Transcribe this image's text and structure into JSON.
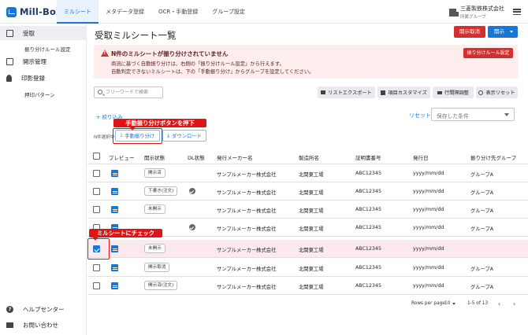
{
  "app": {
    "logo_text": "Mill-Box"
  },
  "nav": {
    "tabs": [
      {
        "label": "ミルシート",
        "active": true
      },
      {
        "label": "メタデータ登録",
        "active": false
      },
      {
        "label": "OCR・手動登録",
        "active": false
      },
      {
        "label": "グループ設定",
        "active": false
      }
    ]
  },
  "company": {
    "name": "三菱製鉄株式会社",
    "group": "所属グループ"
  },
  "sidebar": {
    "items": [
      {
        "label": "受取",
        "icon": "inbox-icon",
        "active": true
      },
      {
        "label": "振り分けルール設定",
        "sub": true
      },
      {
        "label": "開示管理",
        "icon": "share-icon"
      },
      {
        "label": "印影登録",
        "icon": "stamp-icon"
      },
      {
        "label": "押印パターン",
        "sub": true
      }
    ],
    "footer": [
      {
        "label": "ヘルプセンター",
        "icon": "help-icon"
      },
      {
        "label": "お問い合わせ",
        "icon": "mail-icon"
      }
    ]
  },
  "page": {
    "title": "受取ミルシート一覧",
    "cancel_button": "開示取消",
    "open_button": "開示"
  },
  "alert": {
    "title": "N件のミルシートが振り分けされていません",
    "line1": "商流に基づく自動振り分けは、右側の「振り分けルール設定」から行えます。",
    "line2": "自動判定できないミルシートは、下の「手動振り分け」からグループを設定してください。",
    "button": "振り分けルール設定"
  },
  "toolbar": {
    "search_placeholder": "フリーワードで検索",
    "buttons": [
      {
        "label": "リストエクスポート",
        "icon": "download-icon"
      },
      {
        "label": "項目カスタマイズ",
        "icon": "grid-icon"
      },
      {
        "label": "行間隔調整",
        "icon": "density-icon"
      },
      {
        "label": "表示リセット",
        "icon": "refresh-icon"
      }
    ]
  },
  "filters": {
    "add_filter": "+ 絞り込み",
    "reset": "リセット",
    "saved_placeholder": "保存した条件"
  },
  "selection": {
    "count_text": "N件選択中",
    "manual_assign": "手動振り分け",
    "download": "ダウンロード"
  },
  "callouts": {
    "manual_assign": "手動振り分けボタンを押下",
    "check_mill": "ミルシートにチェック"
  },
  "table": {
    "headers": [
      "プレビュー",
      "開示状態",
      "DL状態",
      "発行メーカー名",
      "製造所名",
      "証明書番号",
      "発行日",
      "振り分け先グループ"
    ],
    "rows": [
      {
        "checked": false,
        "status": "開示済",
        "dl": false,
        "maker": "サンプルメーカー株式会社",
        "plant": "北関東工場",
        "cert": "ABC12345",
        "date": "yyyy/mm/dd",
        "group": "グループA"
      },
      {
        "checked": false,
        "status": "下書き(注文)",
        "dl": true,
        "maker": "サンプルメーカー株式会社",
        "plant": "北関東工場",
        "cert": "ABC12345",
        "date": "yyyy/mm/dd",
        "group": "グループA"
      },
      {
        "checked": false,
        "status": "未開示",
        "dl": false,
        "maker": "サンプルメーカー株式会社",
        "plant": "北関東工場",
        "cert": "ABC12345",
        "date": "yyyy/mm/dd",
        "group": "グループA"
      },
      {
        "checked": false,
        "status": "",
        "dl": true,
        "maker": "サンプルメーカー株式会社",
        "plant": "北関東工場",
        "cert": "ABC12345",
        "date": "yyyy/mm/dd",
        "group": "グループA"
      },
      {
        "checked": true,
        "status": "未開示",
        "dl": false,
        "maker": "サンプルメーカー株式会社",
        "plant": "北関東工場",
        "cert": "ABC12345",
        "date": "yyyy/mm/dd",
        "group": ""
      },
      {
        "checked": false,
        "status": "開示取消",
        "dl": false,
        "maker": "サンプルメーカー株式会社",
        "plant": "北関東工場",
        "cert": "ABC12345",
        "date": "yyyy/mm/dd",
        "group": "グループA"
      },
      {
        "checked": false,
        "status": "開示済(注文)",
        "dl": false,
        "maker": "サンプルメーカー株式会社",
        "plant": "北関東工場",
        "cert": "ABC12345",
        "date": "yyyy/mm/dd",
        "group": "グループA"
      }
    ]
  },
  "pagination": {
    "rows_label": "Rows per page:",
    "rows_value": "10",
    "range": "1-5 of 13"
  },
  "colors": {
    "primary": "#1976d2",
    "danger": "#d32f2f",
    "callout": "#e01414",
    "alert_bg": "#fdeded"
  }
}
